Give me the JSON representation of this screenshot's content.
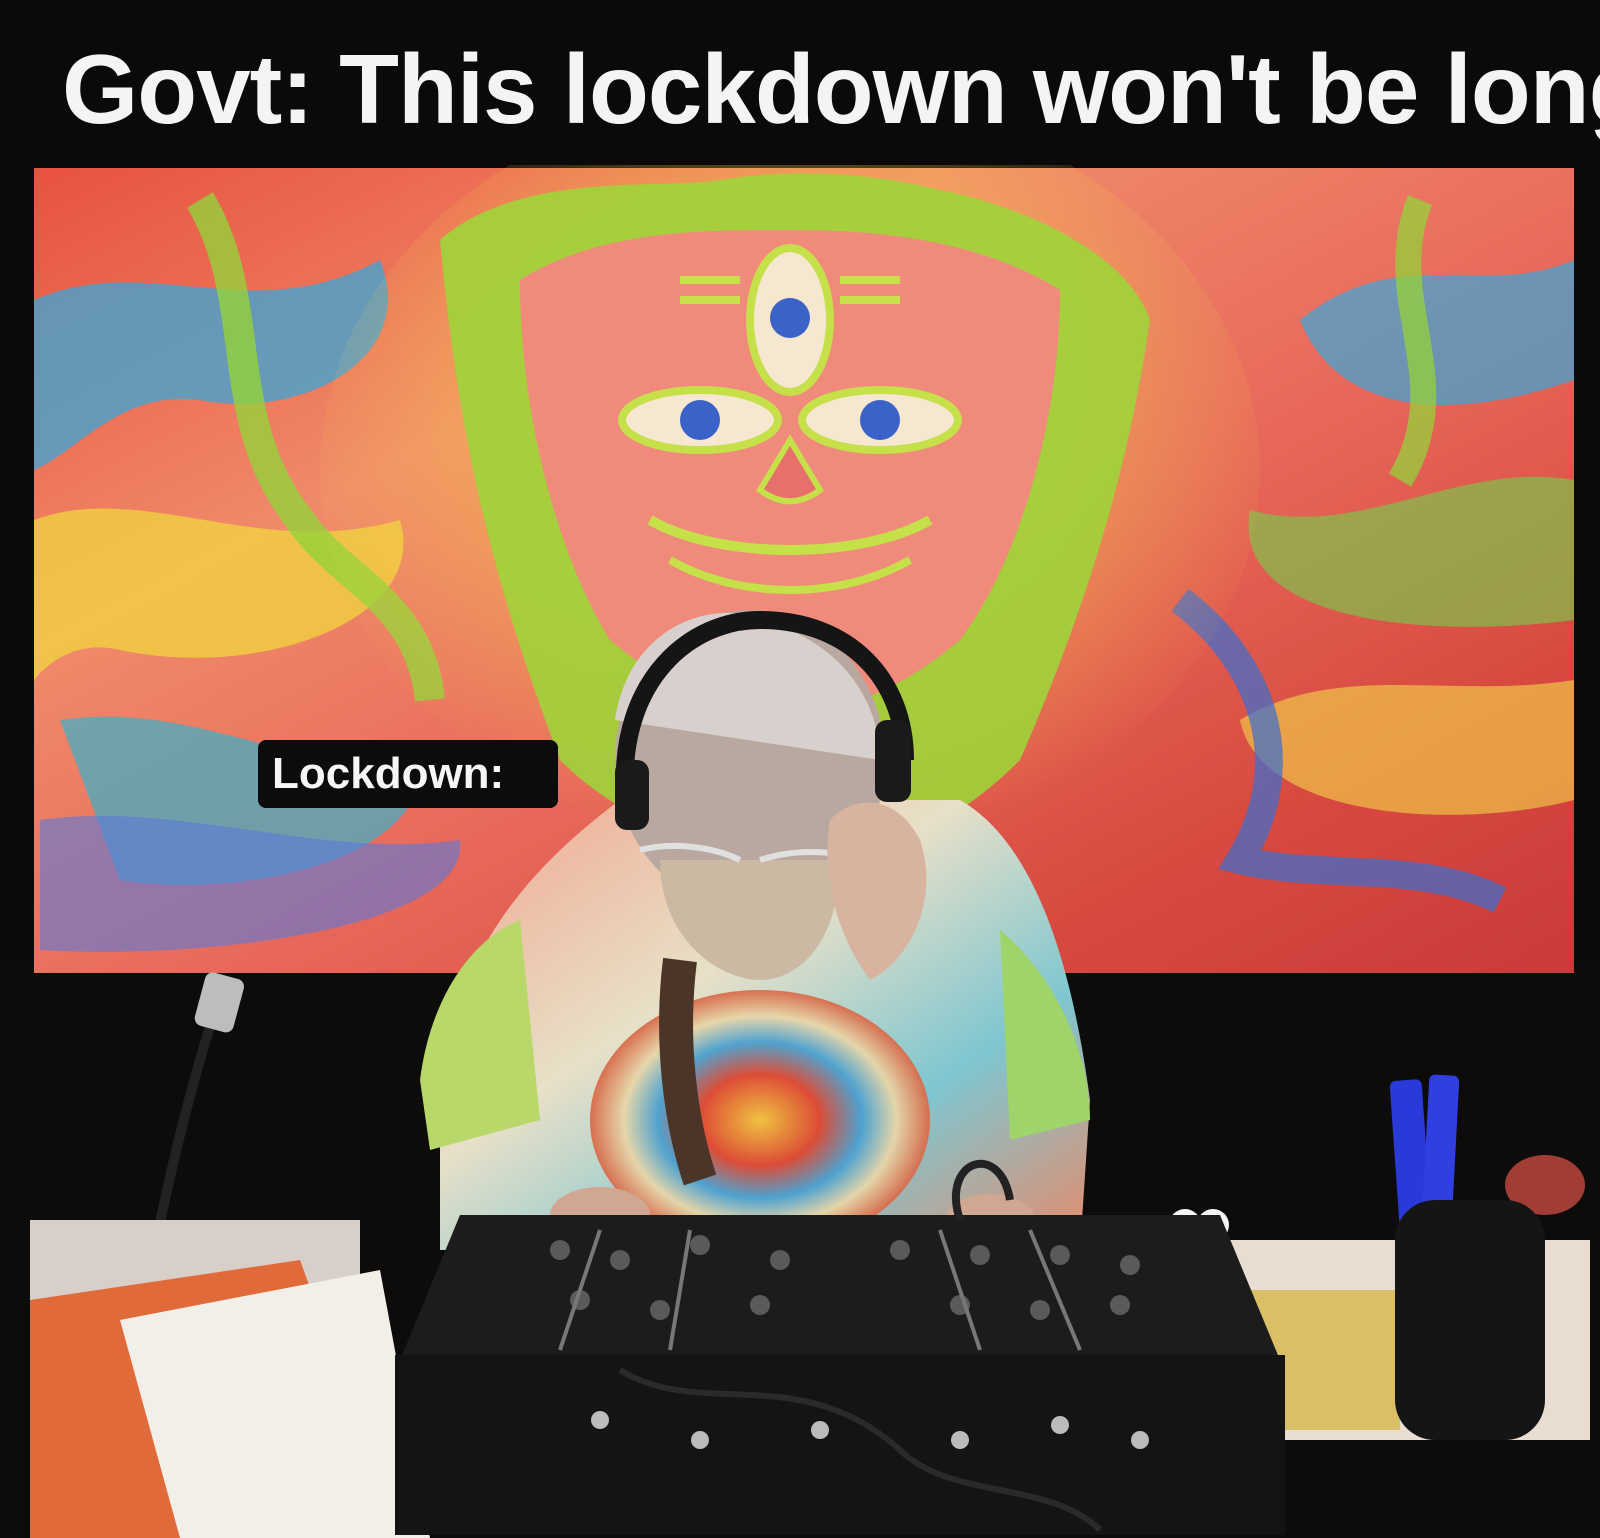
{
  "meme": {
    "top_caption": "Govt: This lockdown won't be long",
    "overlay_label": "Lockdown:"
  },
  "colors": {
    "background": "#0c0a0a",
    "caption_text": "#f4f4f4",
    "label_box": "#0d0c0c",
    "mural_pink": "#f0857a",
    "mural_green": "#9ed23a",
    "mural_blue": "#3aa6d8"
  },
  "icons": {
    "mural": "psychedelic-mural-illustration",
    "person": "dj-with-headphones-illustration",
    "mixer": "dj-mixer-illustration"
  }
}
